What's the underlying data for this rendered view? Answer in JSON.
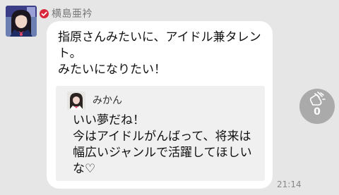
{
  "post": {
    "sender_name": "横島亜衿",
    "text": "指原さんみたいに、アイドル兼タレント。\nみたいになりたい！",
    "timestamp": "21:14"
  },
  "quote": {
    "name": "みかん",
    "text": "いい夢だね！\n今はアイドルがんばって、将来は幅広いジャンルで活躍してほしいな♡"
  },
  "reaction": {
    "icon": "clap-icon",
    "count": "0"
  },
  "icons": {
    "verified": "verified-check-icon"
  },
  "colors": {
    "background": "#e6e6e6",
    "bubble": "#ffffff",
    "quote_bg": "#f0f0f0",
    "verified": "#d8263a",
    "clap_button": "#aaaaaa"
  }
}
